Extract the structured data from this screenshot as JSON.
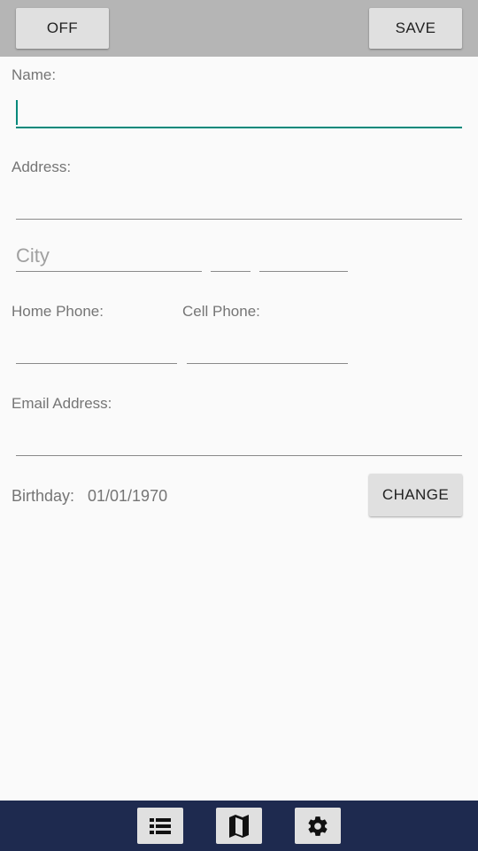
{
  "toolbar": {
    "off_label": "OFF",
    "save_label": "SAVE"
  },
  "form": {
    "name_label": "Name:",
    "name_value": "",
    "address_label": "Address:",
    "address_value": "",
    "city_placeholder": "City",
    "state_value": "",
    "zip_value": "",
    "home_phone_label": "Home Phone:",
    "cell_phone_label": "Cell Phone:",
    "email_label": "Email Address:",
    "birthday_label": "Birthday:",
    "birthday_value": "01/01/1970",
    "change_label": "CHANGE"
  },
  "bottom_nav": {
    "items": [
      {
        "icon": "list-icon"
      },
      {
        "icon": "map-icon"
      },
      {
        "icon": "gear-icon"
      }
    ],
    "background": "#1e2a4f"
  },
  "colors": {
    "accent": "#00897b",
    "toolbar": "#b5b5b5",
    "button": "#e0e0e0"
  }
}
